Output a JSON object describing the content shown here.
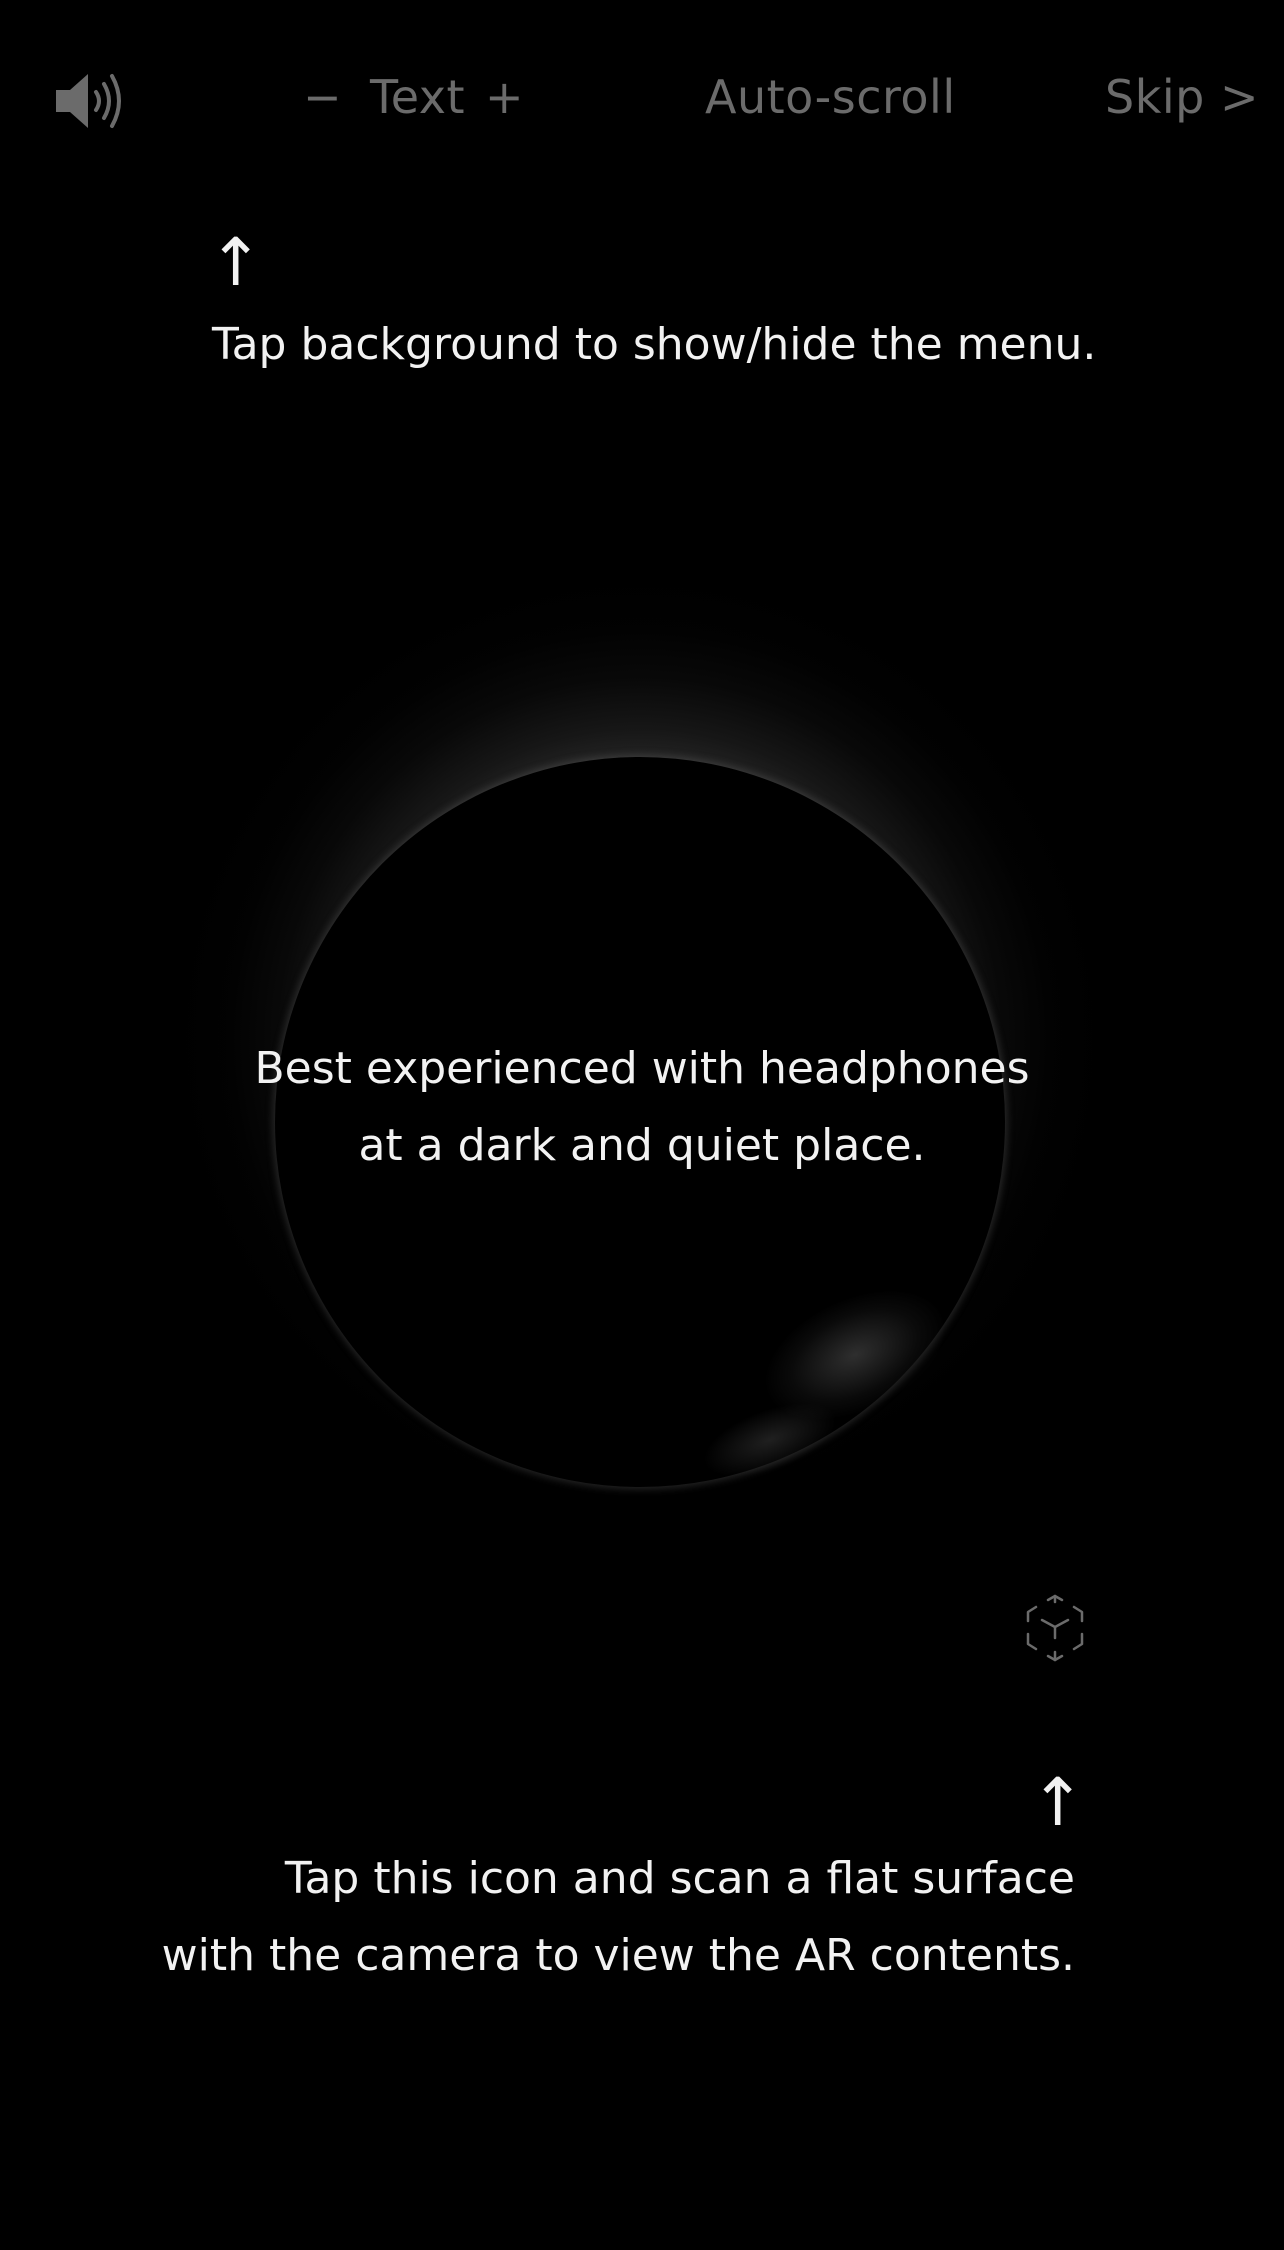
{
  "menu": {
    "sound_icon": "speaker-volume-icon",
    "text_decrease": "−",
    "text_label": "Text",
    "text_increase": "+",
    "auto_scroll": "Auto-scroll",
    "skip": "Skip >"
  },
  "hints": {
    "top_arrow": "↑",
    "top_text": "Tap background to show/hide the menu.",
    "center_line1": "Best experienced with headphones",
    "center_line2": "at a dark and quiet place.",
    "ar_icon": "ar-cube-icon",
    "bottom_arrow": "↑",
    "bottom_line1": "Tap this icon and scan a flat surface",
    "bottom_line2": "with the camera to view the AR contents."
  },
  "colors": {
    "background": "#000000",
    "menu_text": "#6b6b6b",
    "hint_text": "#f2f2f2"
  }
}
